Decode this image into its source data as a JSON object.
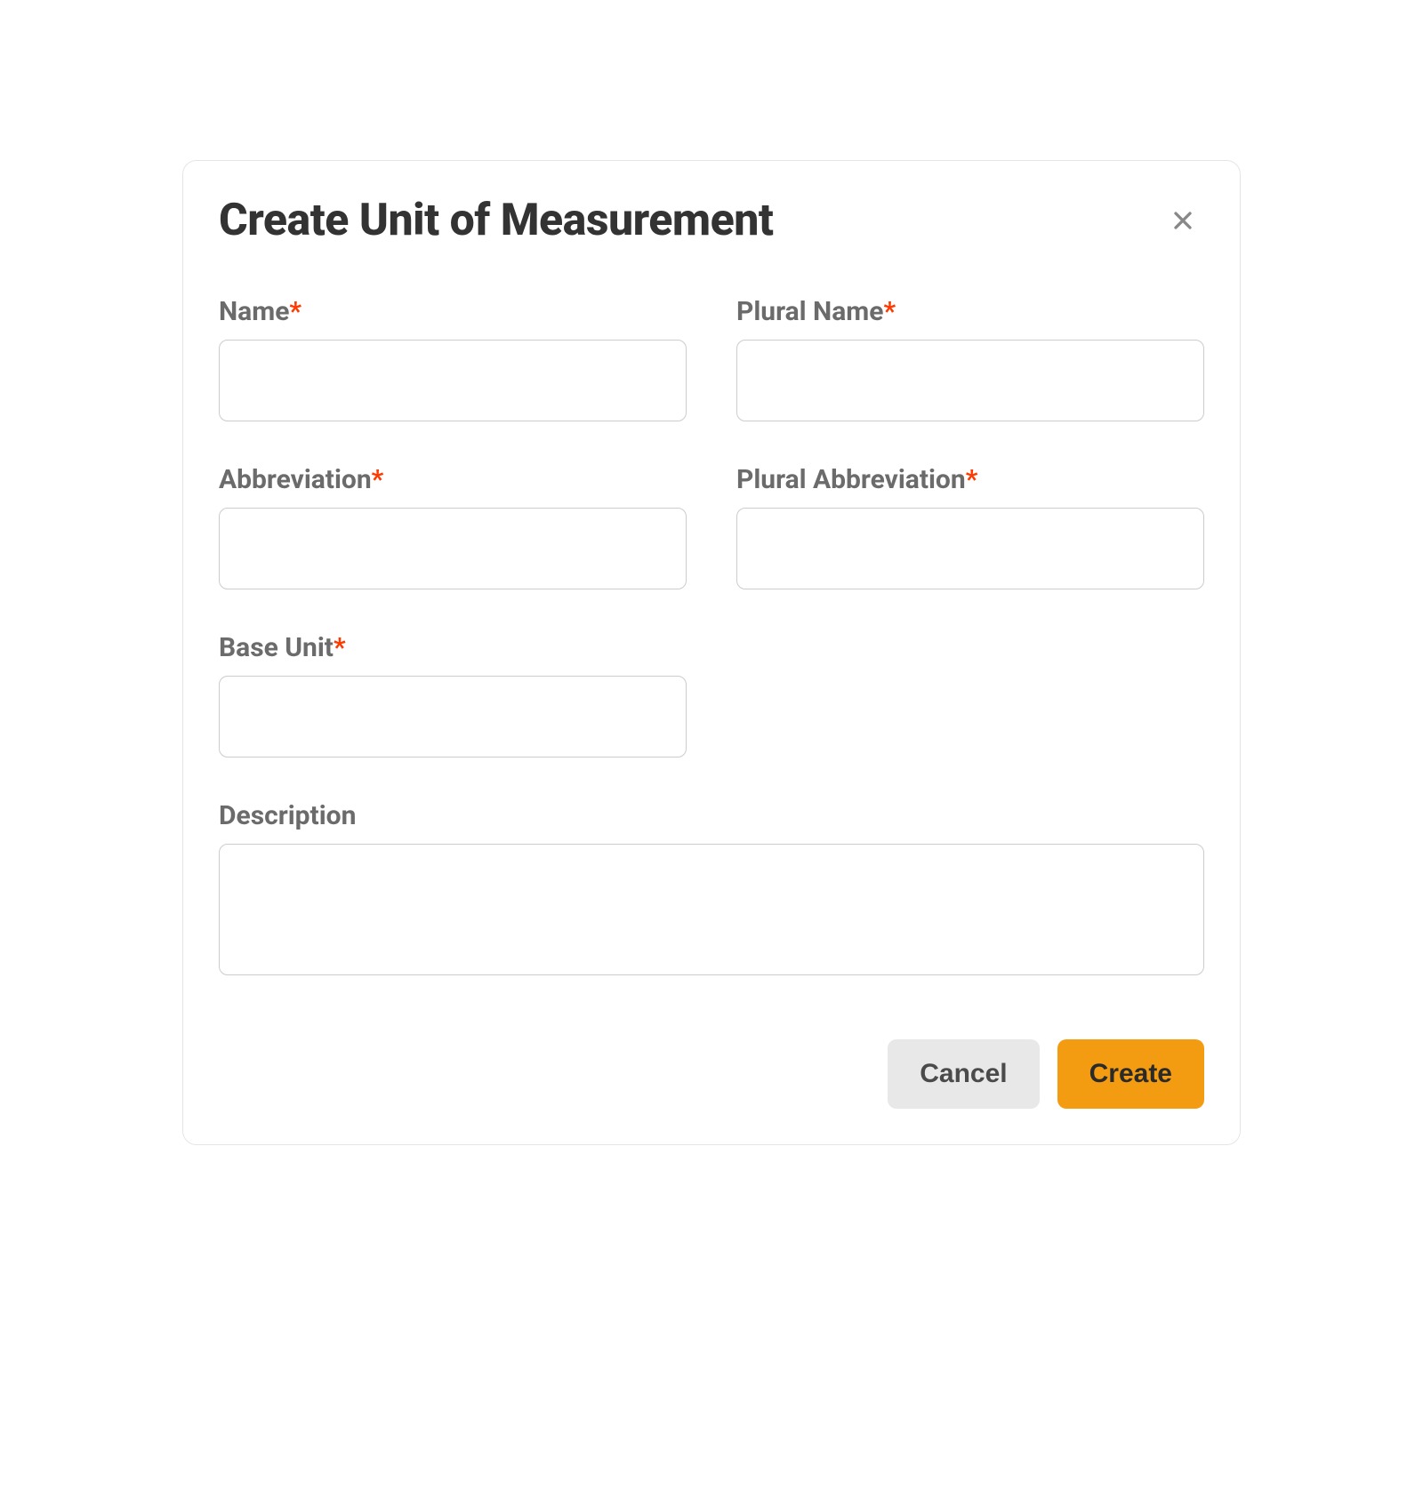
{
  "modal": {
    "title": "Create Unit of Measurement",
    "fields": {
      "name": {
        "label": "Name",
        "required": true,
        "value": ""
      },
      "plural_name": {
        "label": "Plural Name",
        "required": true,
        "value": ""
      },
      "abbreviation": {
        "label": "Abbreviation",
        "required": true,
        "value": ""
      },
      "plural_abbreviation": {
        "label": "Plural Abbreviation",
        "required": true,
        "value": ""
      },
      "base_unit": {
        "label": "Base Unit",
        "required": true,
        "value": ""
      },
      "description": {
        "label": "Description",
        "required": false,
        "value": ""
      }
    },
    "buttons": {
      "cancel": "Cancel",
      "create": "Create"
    },
    "required_marker": "*"
  }
}
